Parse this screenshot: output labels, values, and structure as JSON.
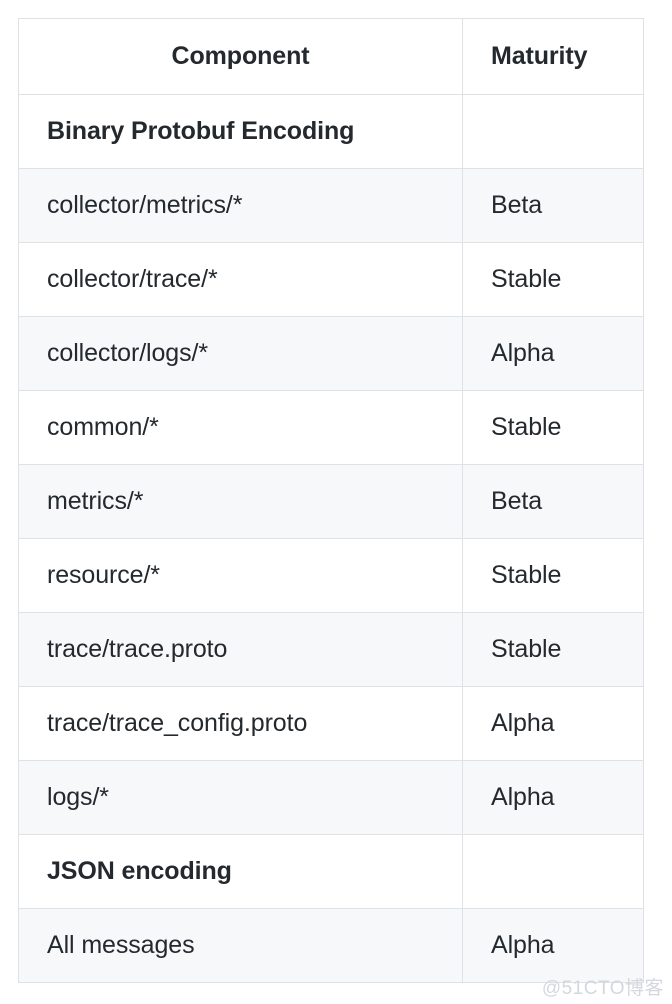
{
  "table": {
    "columns": [
      {
        "key": "component",
        "label": "Component",
        "align": "center"
      },
      {
        "key": "maturity",
        "label": "Maturity",
        "align": "left"
      }
    ],
    "rows": [
      {
        "component": "Binary Protobuf Encoding",
        "maturity": "",
        "section": true
      },
      {
        "component": "collector/metrics/*",
        "maturity": "Beta",
        "section": false
      },
      {
        "component": "collector/trace/*",
        "maturity": "Stable",
        "section": false
      },
      {
        "component": "collector/logs/*",
        "maturity": "Alpha",
        "section": false
      },
      {
        "component": "common/*",
        "maturity": "Stable",
        "section": false
      },
      {
        "component": "metrics/*",
        "maturity": "Beta",
        "section": false
      },
      {
        "component": "resource/*",
        "maturity": "Stable",
        "section": false
      },
      {
        "component": "trace/trace.proto",
        "maturity": "Stable",
        "section": false
      },
      {
        "component": "trace/trace_config.proto",
        "maturity": "Alpha",
        "section": false
      },
      {
        "component": "logs/*",
        "maturity": "Alpha",
        "section": false
      },
      {
        "component": "JSON encoding",
        "maturity": "",
        "section": true
      },
      {
        "component": "All messages",
        "maturity": "Alpha",
        "section": false
      }
    ]
  },
  "watermark": {
    "text": "@51CTO博客"
  },
  "colors": {
    "text": "#24292e",
    "border": "#dfe2e5",
    "stripe": "#f6f8fa",
    "background": "#ffffff",
    "watermark": "#d4d7dd"
  }
}
